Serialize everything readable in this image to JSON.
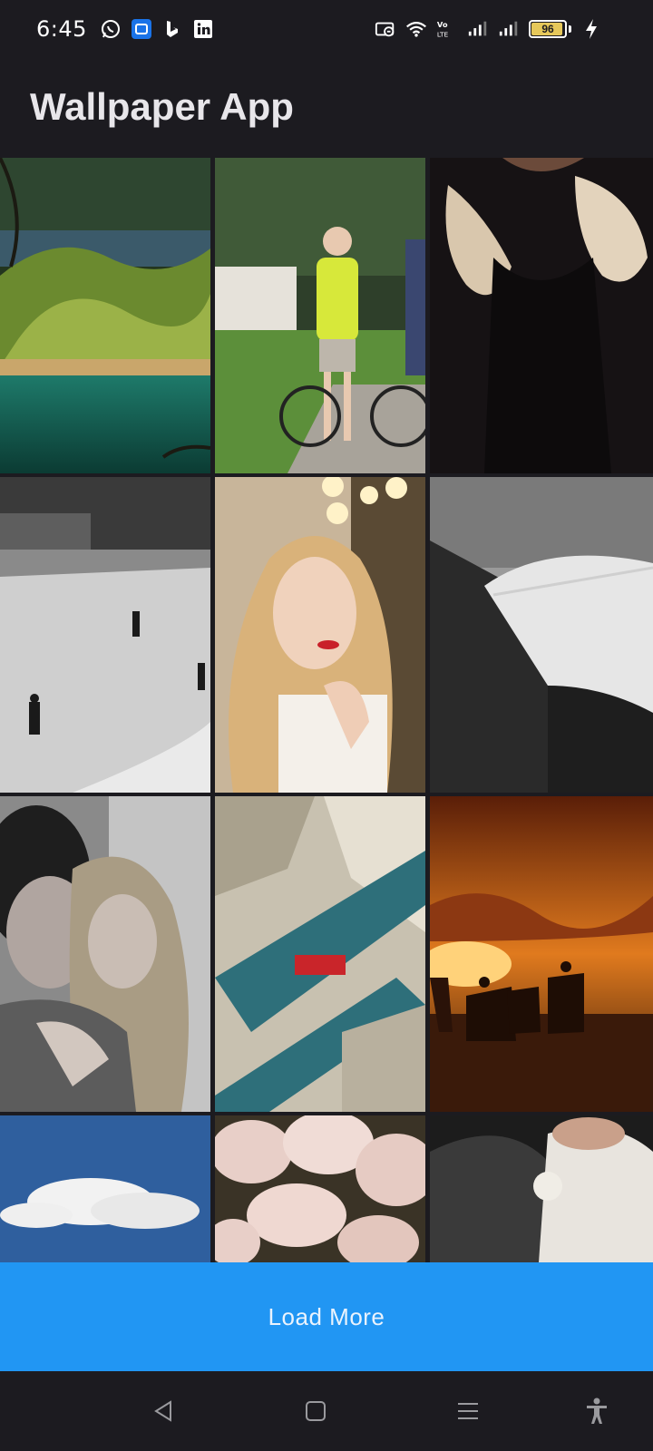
{
  "status_bar": {
    "time": "6:45",
    "battery": "96",
    "left_icons": [
      "whatsapp-icon",
      "app-notification-icon",
      "bing-icon",
      "linkedin-icon"
    ],
    "right_icons": [
      "cast-icon",
      "wifi-icon",
      "volte-icon",
      "signal-icon",
      "signal-icon",
      "battery-icon",
      "charging-icon"
    ]
  },
  "app_bar": {
    "title": "Wallpaper App"
  },
  "wallpapers": [
    {
      "subject": "lake-forest"
    },
    {
      "subject": "cyclists"
    },
    {
      "subject": "fur-coat"
    },
    {
      "subject": "beach-walkers"
    },
    {
      "subject": "blonde-portrait"
    },
    {
      "subject": "fortress-wall"
    },
    {
      "subject": "couple-embrace"
    },
    {
      "subject": "city-aerial"
    },
    {
      "subject": "horse-riders-sunset"
    },
    {
      "subject": "clouds-sky"
    },
    {
      "subject": "pink-roses"
    },
    {
      "subject": "dancers"
    }
  ],
  "load_more": {
    "label": "Load More"
  },
  "nav_bar": {
    "buttons": [
      "back-icon",
      "home-icon",
      "recents-icon",
      "accessibility-icon"
    ]
  },
  "colors": {
    "background": "#1c1b20",
    "accent": "#2196f3",
    "title": "#e8e6ea"
  }
}
